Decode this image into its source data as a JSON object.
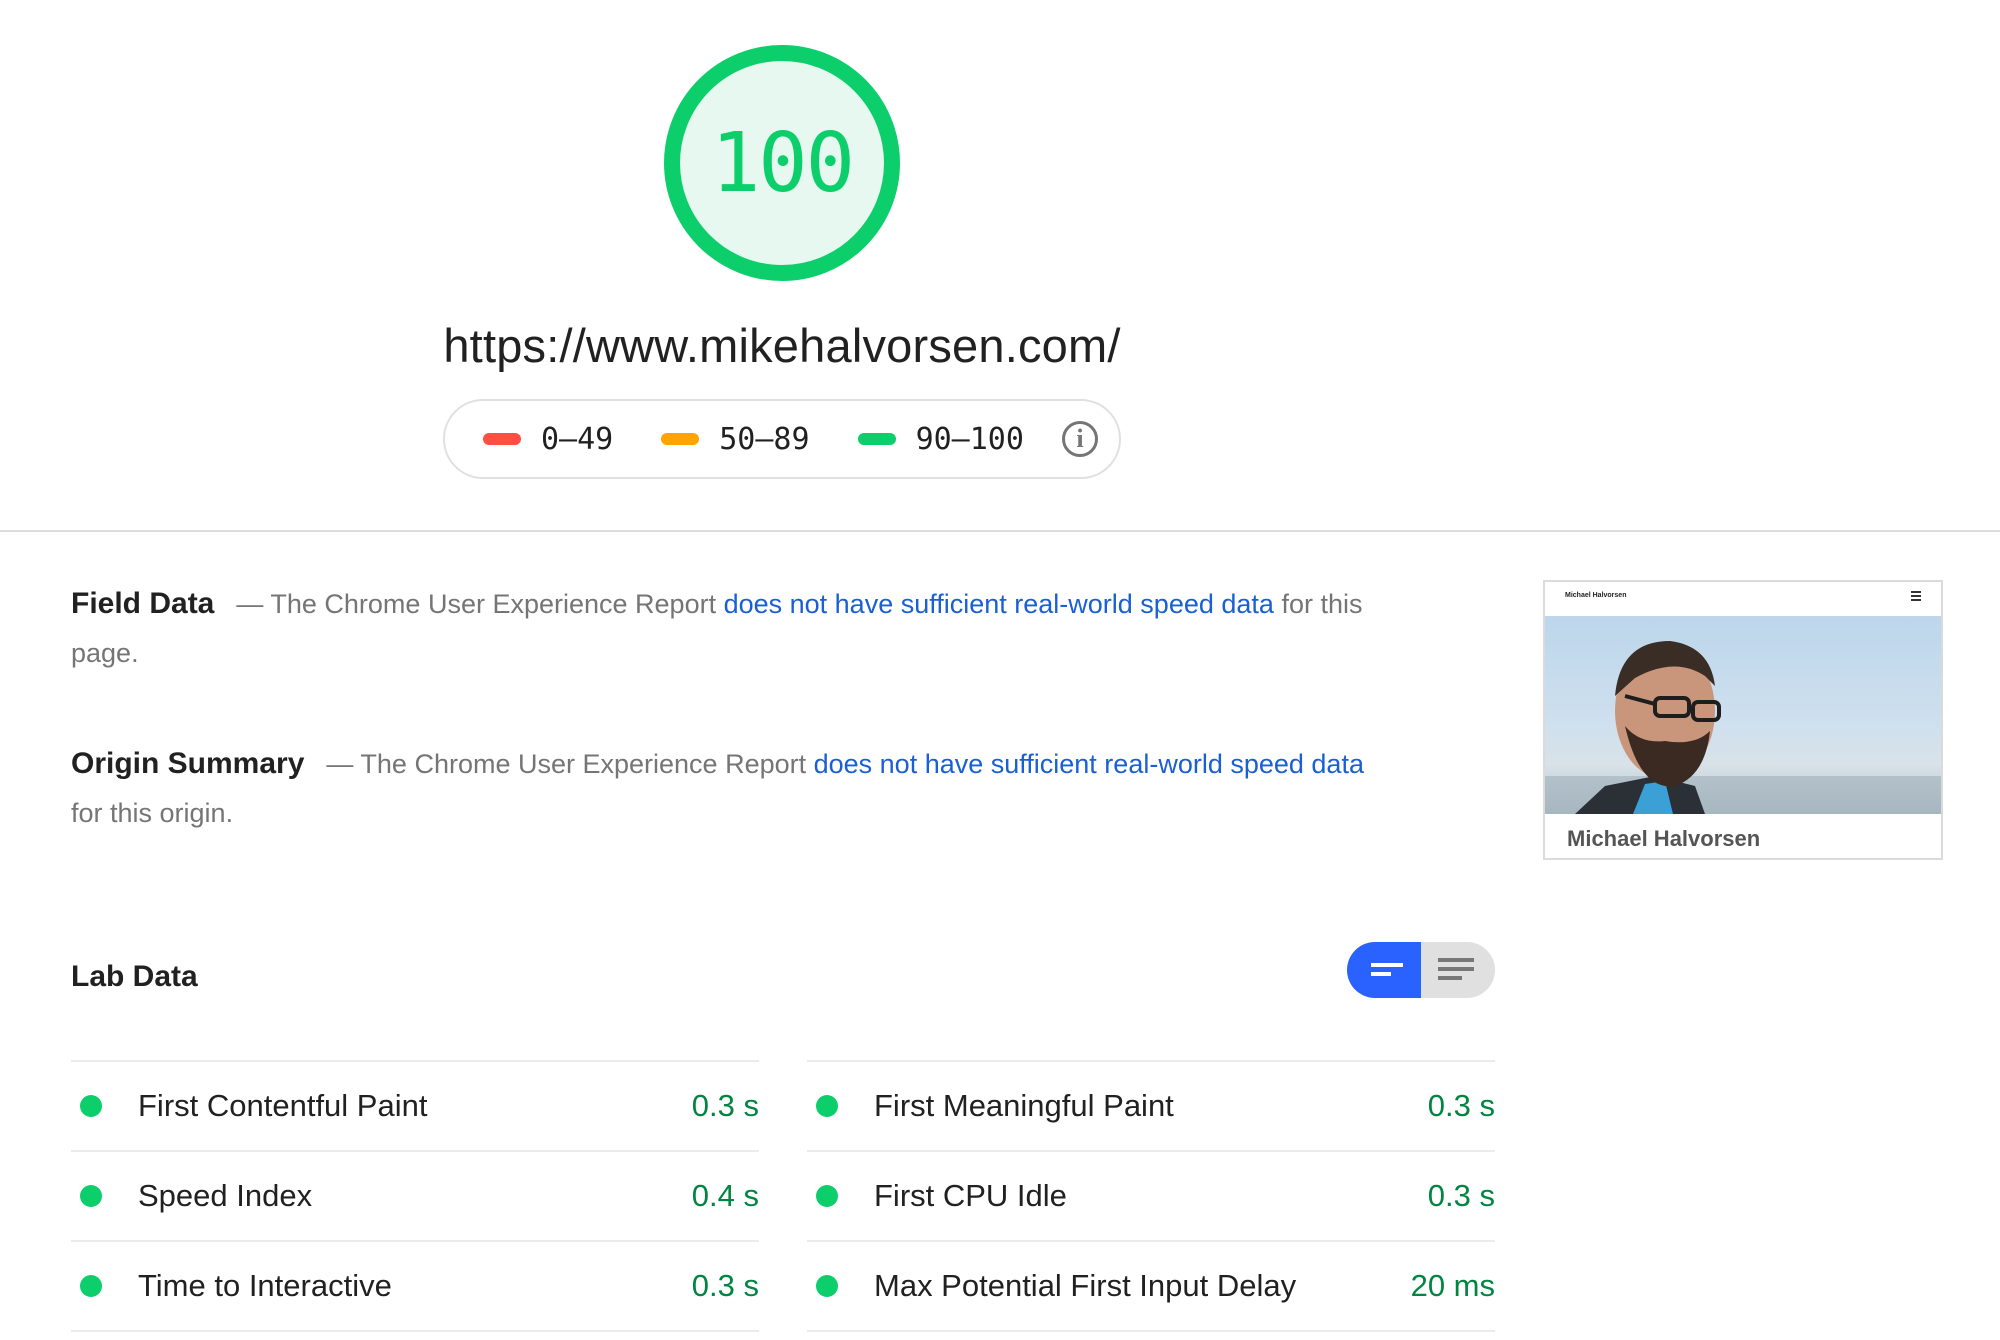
{
  "score": {
    "value": "100",
    "fraction": 1.0,
    "color": "#0cce6b",
    "fill_color": "#e6f8ef"
  },
  "url": "https://www.mikehalvorsen.com/",
  "legend": {
    "items": [
      {
        "label": "0–49",
        "color": "#ff4e42"
      },
      {
        "label": "50–89",
        "color": "#ffa400"
      },
      {
        "label": "90–100",
        "color": "#0cce6b"
      }
    ],
    "info_icon": "info-icon"
  },
  "field_data": {
    "title": "Field Data",
    "prefix": "— The Chrome User Experience Report ",
    "link": "does not have sufficient real-world speed data",
    "suffix": " for this page."
  },
  "origin_summary": {
    "title": "Origin Summary",
    "prefix": "— The Chrome User Experience Report ",
    "link": "does not have sufficient real-world speed data",
    "suffix": " for this origin."
  },
  "thumbnail": {
    "site_title": "Michael Halvorsen",
    "caption": "Michael Halvorsen",
    "menu_icon": "hamburger-icon"
  },
  "lab_data": {
    "title": "Lab Data",
    "toggle": {
      "active": "summary-view",
      "inactive": "detail-view"
    },
    "metrics_left": [
      {
        "label": "First Contentful Paint",
        "value": "0.3 s"
      },
      {
        "label": "Speed Index",
        "value": "0.4 s"
      },
      {
        "label": "Time to Interactive",
        "value": "0.3 s"
      }
    ],
    "metrics_right": [
      {
        "label": "First Meaningful Paint",
        "value": "0.3 s"
      },
      {
        "label": "First CPU Idle",
        "value": "0.3 s"
      },
      {
        "label": "Max Potential First Input Delay",
        "value": "20 ms"
      }
    ],
    "status_color": "#0cce6b",
    "value_color": "#018642"
  }
}
